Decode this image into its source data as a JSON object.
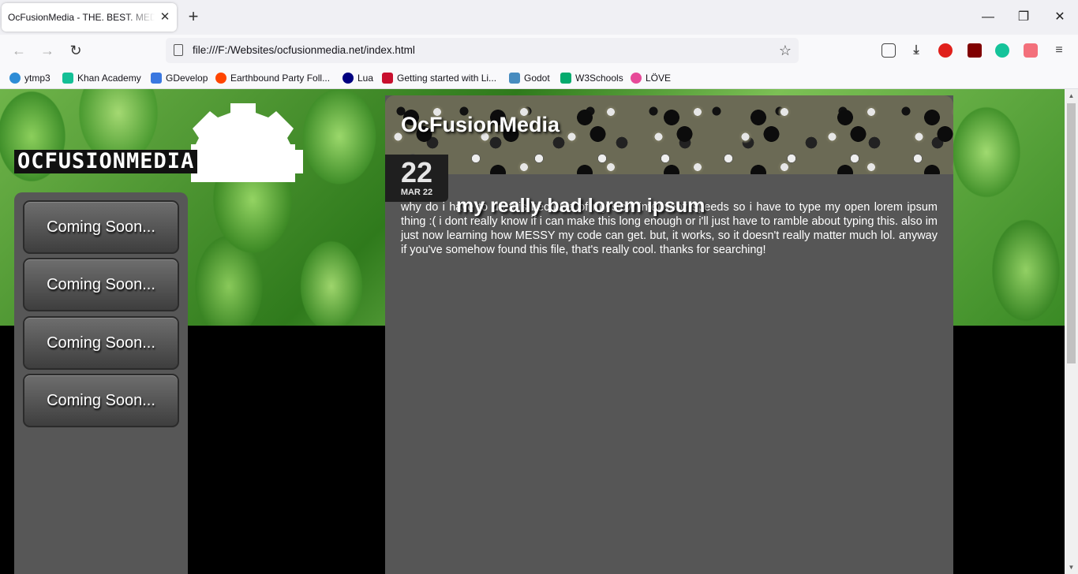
{
  "browser": {
    "tab_title": "OcFusionMedia - THE. BEST. MEDIA",
    "tab_close": "✕",
    "new_tab": "+",
    "url": "file:///F:/Websites/ocfusionmedia.net/index.html",
    "window_controls": {
      "minimize": "—",
      "restore": "❐",
      "close": "✕"
    },
    "nav": {
      "back": "←",
      "forward": "→",
      "reload": "↻"
    },
    "bookmarks": [
      {
        "label": "ytmp3",
        "icon": "ytmp3-icon",
        "color": "#2d8cd6"
      },
      {
        "label": "Khan Academy",
        "icon": "khan-academy-icon",
        "color": "#14bf96"
      },
      {
        "label": "GDevelop",
        "icon": "gdevelop-icon",
        "color": "#3a78e0"
      },
      {
        "label": "Earthbound Party Foll...",
        "icon": "reddit-icon",
        "color": "#ff4500"
      },
      {
        "label": "Lua",
        "icon": "lua-icon",
        "color": "#000080"
      },
      {
        "label": "Getting started with Li...",
        "icon": "pcw-icon",
        "color": "#c8102e"
      },
      {
        "label": "Godot",
        "icon": "godot-icon",
        "color": "#478cbf"
      },
      {
        "label": "W3Schools",
        "icon": "w3schools-icon",
        "color": "#04aa6d"
      },
      {
        "label": "LÖVE",
        "icon": "love-icon",
        "color": "#e74a99"
      }
    ]
  },
  "site": {
    "logo_text": "OCFUSIONMEDIA",
    "sidebar_buttons": [
      "Coming Soon...",
      "Coming Soon...",
      "Coming Soon...",
      "Coming Soon..."
    ],
    "banner_title": "OcFusionMedia",
    "post": {
      "day": "22",
      "month": "MAR 22",
      "title": "my really bad lorem ipsum",
      "body": "why do i have to do this because of my slow interwebz speeds so i have to type my open lorem ipsum thing :( i dont really know if i can make this long enough or i'll just have to ramble about typing this. also im just now learning how MESSY my code can get. but, it works, so it doesn't really matter much lol. anyway if you've somehow found this file, that's really cool. thanks for searching!"
    }
  },
  "colors": {
    "sidebar_bg": "#575757",
    "content_bg": "#565656",
    "page_bg": "#000000"
  }
}
